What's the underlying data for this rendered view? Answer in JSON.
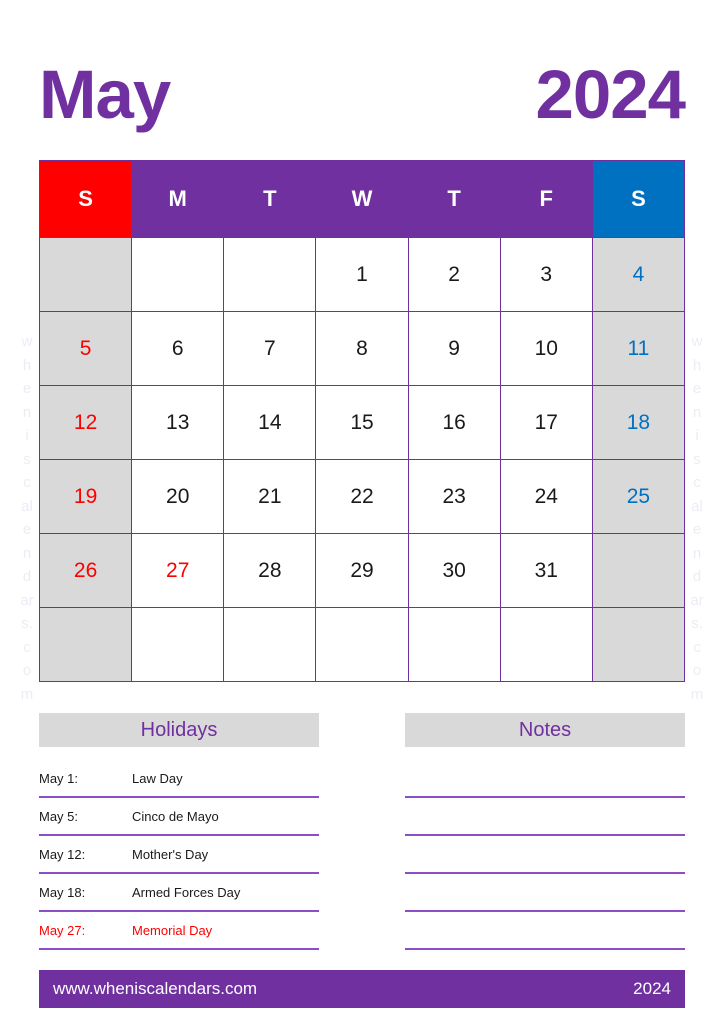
{
  "title": {
    "month": "May",
    "year": "2024"
  },
  "colors": {
    "purple": "#7030a0",
    "red": "#ff0000",
    "blue": "#0070c0",
    "gray": "#d9d9d9",
    "line": "#8e4ec6"
  },
  "watermark": {
    "text": "wheniscalendars.com",
    "chars": [
      "w",
      "h",
      "e",
      "n",
      "i",
      "s",
      "c",
      "al",
      "e",
      "n",
      "d",
      "ar",
      "s.",
      "c",
      "o",
      "m"
    ]
  },
  "calendar": {
    "weekday_headers": [
      {
        "label": "S",
        "name": "sunday",
        "style": "sun"
      },
      {
        "label": "M",
        "name": "monday",
        "style": "weekday"
      },
      {
        "label": "T",
        "name": "tuesday",
        "style": "weekday"
      },
      {
        "label": "W",
        "name": "wednesday",
        "style": "weekday"
      },
      {
        "label": "T",
        "name": "thursday",
        "style": "weekday"
      },
      {
        "label": "F",
        "name": "friday",
        "style": "weekday"
      },
      {
        "label": "S",
        "name": "saturday",
        "style": "sat"
      }
    ],
    "weeks": [
      [
        {
          "day": "",
          "kind": "empty-sun"
        },
        {
          "day": "",
          "kind": "empty"
        },
        {
          "day": "",
          "kind": "empty"
        },
        {
          "day": "1",
          "kind": "normal"
        },
        {
          "day": "2",
          "kind": "normal"
        },
        {
          "day": "3",
          "kind": "normal"
        },
        {
          "day": "4",
          "kind": "sat"
        }
      ],
      [
        {
          "day": "5",
          "kind": "sun"
        },
        {
          "day": "6",
          "kind": "normal"
        },
        {
          "day": "7",
          "kind": "normal"
        },
        {
          "day": "8",
          "kind": "normal"
        },
        {
          "day": "9",
          "kind": "normal"
        },
        {
          "day": "10",
          "kind": "normal"
        },
        {
          "day": "11",
          "kind": "sat"
        }
      ],
      [
        {
          "day": "12",
          "kind": "sun"
        },
        {
          "day": "13",
          "kind": "normal"
        },
        {
          "day": "14",
          "kind": "normal"
        },
        {
          "day": "15",
          "kind": "normal"
        },
        {
          "day": "16",
          "kind": "normal"
        },
        {
          "day": "17",
          "kind": "normal"
        },
        {
          "day": "18",
          "kind": "sat"
        }
      ],
      [
        {
          "day": "19",
          "kind": "sun"
        },
        {
          "day": "20",
          "kind": "normal"
        },
        {
          "day": "21",
          "kind": "normal"
        },
        {
          "day": "22",
          "kind": "normal"
        },
        {
          "day": "23",
          "kind": "normal"
        },
        {
          "day": "24",
          "kind": "normal"
        },
        {
          "day": "25",
          "kind": "sat"
        }
      ],
      [
        {
          "day": "26",
          "kind": "sun"
        },
        {
          "day": "27",
          "kind": "holiday"
        },
        {
          "day": "28",
          "kind": "normal"
        },
        {
          "day": "29",
          "kind": "normal"
        },
        {
          "day": "30",
          "kind": "normal"
        },
        {
          "day": "31",
          "kind": "normal"
        },
        {
          "day": "",
          "kind": "empty-sat"
        }
      ],
      [
        {
          "day": "",
          "kind": "empty-sun"
        },
        {
          "day": "",
          "kind": "empty"
        },
        {
          "day": "",
          "kind": "empty"
        },
        {
          "day": "",
          "kind": "empty"
        },
        {
          "day": "",
          "kind": "empty"
        },
        {
          "day": "",
          "kind": "empty"
        },
        {
          "day": "",
          "kind": "empty-sat"
        }
      ]
    ]
  },
  "holidays": {
    "heading": "Holidays",
    "items": [
      {
        "date": "May 1:",
        "name": "Law Day",
        "special": false
      },
      {
        "date": "May 5:",
        "name": "Cinco de Mayo",
        "special": false
      },
      {
        "date": "May 12:",
        "name": "Mother's Day",
        "special": false
      },
      {
        "date": "May 18:",
        "name": "Armed Forces Day",
        "special": false
      },
      {
        "date": "May 27:",
        "name": "Memorial Day",
        "special": true
      }
    ]
  },
  "notes": {
    "heading": "Notes",
    "line_count": 5
  },
  "footer": {
    "website": "www.wheniscalendars.com",
    "year": "2024"
  }
}
